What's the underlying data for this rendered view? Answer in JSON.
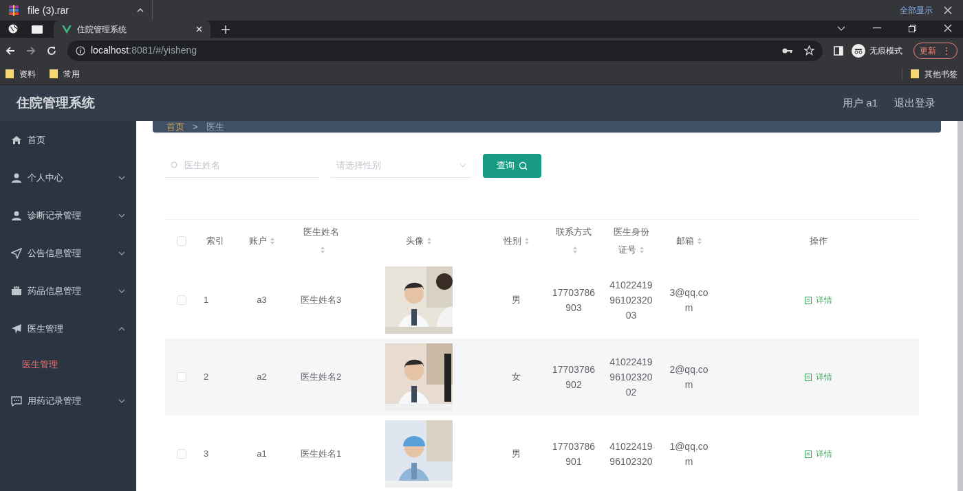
{
  "download_bar": {
    "file": "file (3).rar",
    "show_all": "全部显示"
  },
  "browser": {
    "tab_title": "住院管理系统",
    "url_host": "localhost",
    "url_rest": ":8081/#/yisheng",
    "incognito": "无痕模式",
    "update": "更新",
    "menu": "⋮",
    "bookmarks": [
      "资料",
      "常用"
    ],
    "other_bookmarks": "其他书签"
  },
  "header": {
    "title": "住院管理系统",
    "user": "用户 a1",
    "logout": "退出登录"
  },
  "sidebar": {
    "items": [
      {
        "label": "首页"
      },
      {
        "label": "个人中心",
        "expanded": false
      },
      {
        "label": "诊断记录管理",
        "expanded": false
      },
      {
        "label": "公告信息管理",
        "expanded": false
      },
      {
        "label": "药品信息管理",
        "expanded": false
      },
      {
        "label": "医生管理",
        "expanded": true,
        "children": [
          {
            "label": "医生管理",
            "selected": true
          }
        ]
      },
      {
        "label": "用药记录管理",
        "expanded": false
      }
    ]
  },
  "breadcrumb": {
    "items": [
      "首页",
      "医生"
    ],
    "separator": ">"
  },
  "search": {
    "name_placeholder": "医生姓名",
    "gender_placeholder": "请选择性别",
    "button": "查询"
  },
  "table": {
    "columns": [
      {
        "label": "索引",
        "sortable": false
      },
      {
        "label": "账户",
        "sortable": true
      },
      {
        "label": "医生姓名",
        "sortable": true
      },
      {
        "label": "头像",
        "sortable": true
      },
      {
        "label": "性别",
        "sortable": true
      },
      {
        "label": "联系方式",
        "sortable": true
      },
      {
        "label": "医生身份证号",
        "sortable": true
      },
      {
        "label": "邮箱",
        "sortable": true
      },
      {
        "label": "操作",
        "sortable": false
      }
    ],
    "header_checked": false,
    "rows": [
      {
        "checked": false,
        "index": "1",
        "account": "a3",
        "name": "医生姓名3",
        "gender": "男",
        "phone": "17703786903",
        "id_number": "410224199610232003",
        "email": "3@qq.com",
        "action": "详情"
      },
      {
        "checked": false,
        "index": "2",
        "account": "a2",
        "name": "医生姓名2",
        "gender": "女",
        "phone": "17703786902",
        "id_number": "410224199610232002",
        "email": "2@qq.com",
        "action": "详情"
      },
      {
        "checked": false,
        "index": "3",
        "account": "a1",
        "name": "医生姓名1",
        "gender": "男",
        "phone": "17703786901",
        "id_number": "4102241996102320",
        "email": "1@qq.com",
        "action": "详情"
      }
    ]
  }
}
